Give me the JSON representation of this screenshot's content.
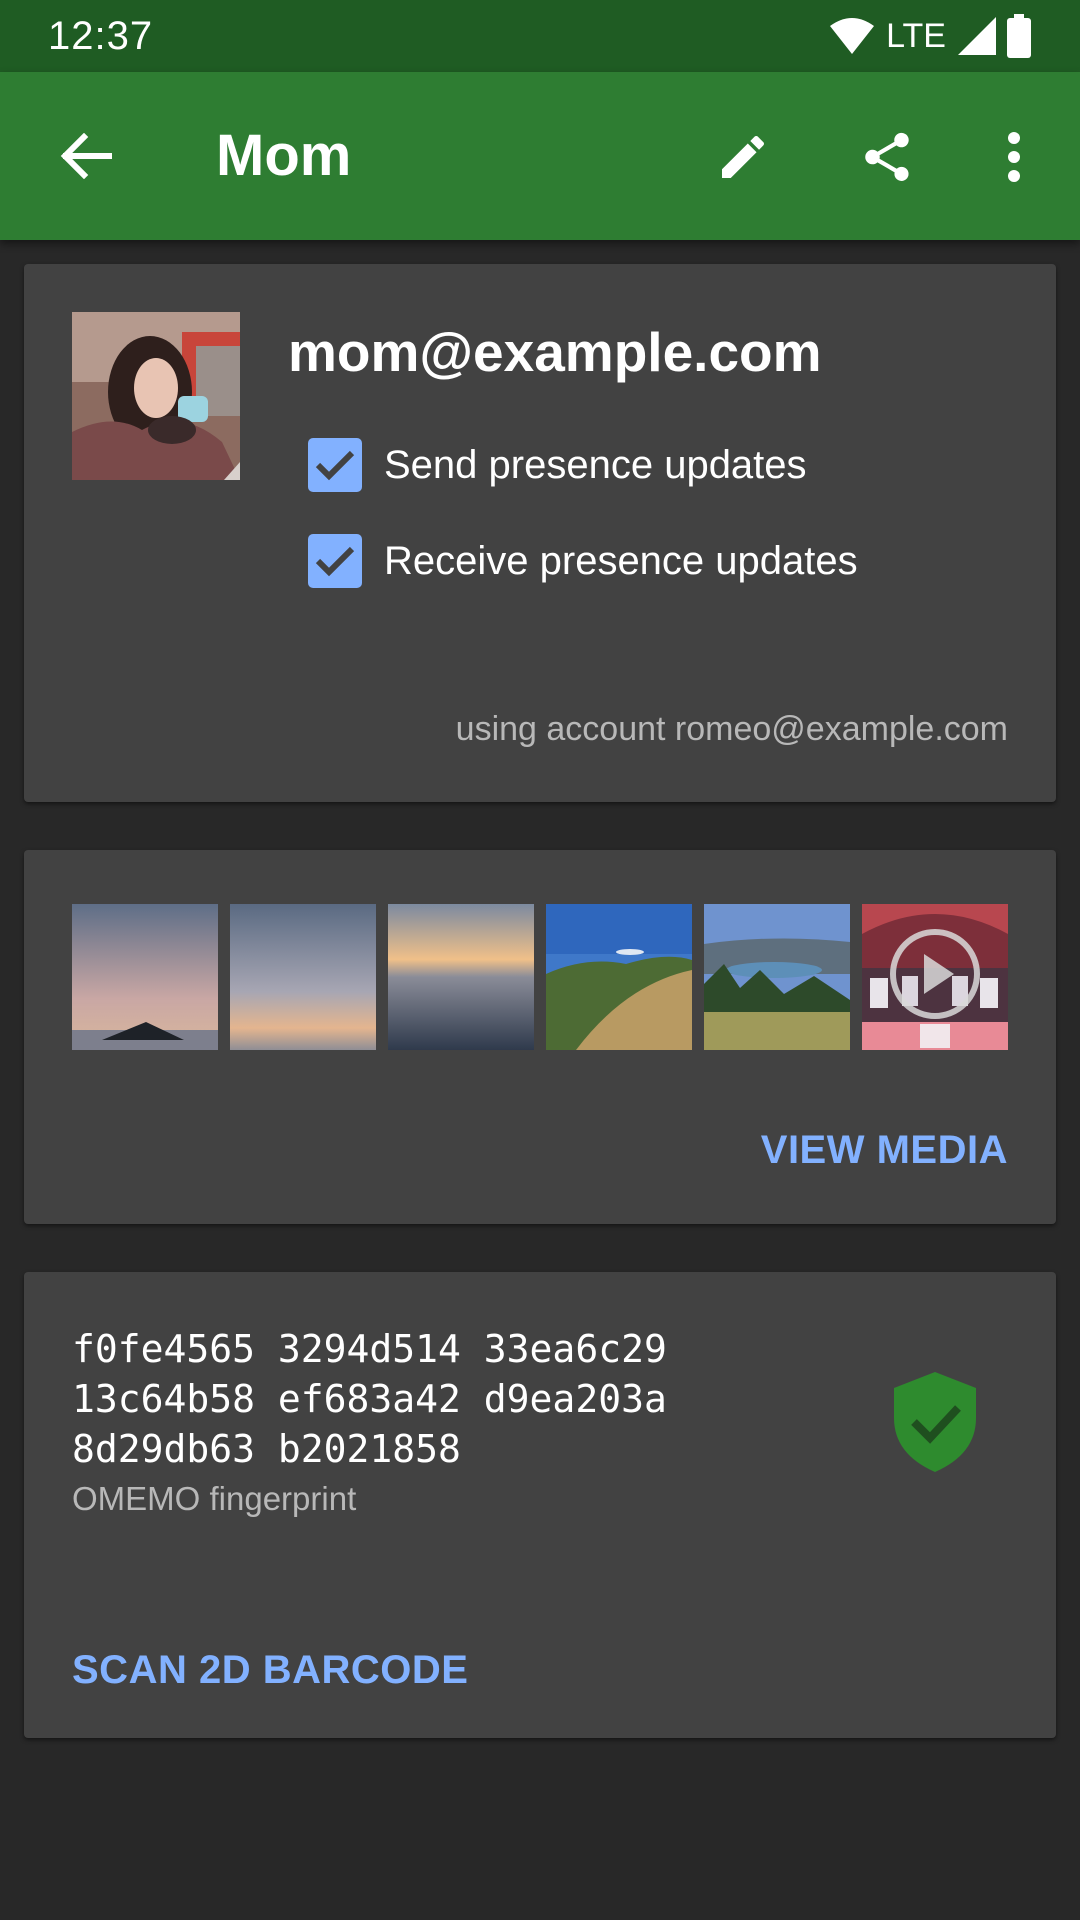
{
  "status_bar": {
    "time": "12:37",
    "network": "LTE",
    "icons": [
      "wifi-icon",
      "signal-icon",
      "battery-icon"
    ]
  },
  "app_bar": {
    "title": "Mom",
    "icons": [
      "back-arrow-icon",
      "pencil-icon",
      "share-icon",
      "more-vert-icon"
    ]
  },
  "contact": {
    "jid": "mom@example.com",
    "send_presence_label": "Send presence updates",
    "send_presence_checked": true,
    "receive_presence_label": "Receive presence updates",
    "receive_presence_checked": true,
    "account_line": "using account romeo@example.com"
  },
  "media": {
    "thumbnails": [
      "sunset-island",
      "sunset-sky",
      "sea-sunset",
      "mountain-meadow",
      "lake-valley",
      "concert-video"
    ],
    "view_media_label": "VIEW MEDIA"
  },
  "omemo": {
    "fingerprint_lines": [
      "f0fe4565 3294d514 33ea6c29",
      "13c64b58 ef683a42 d9ea203a",
      "8d29db63 b2021858"
    ],
    "caption": "OMEMO fingerprint",
    "trusted": true,
    "scan_label": "SCAN 2D BARCODE"
  },
  "colors": {
    "status_bar": "#1f5c23",
    "app_bar": "#2e7d32",
    "background": "#282828",
    "card": "#424242",
    "accent": "#82b1ff",
    "shield": "#2e8b2e"
  }
}
